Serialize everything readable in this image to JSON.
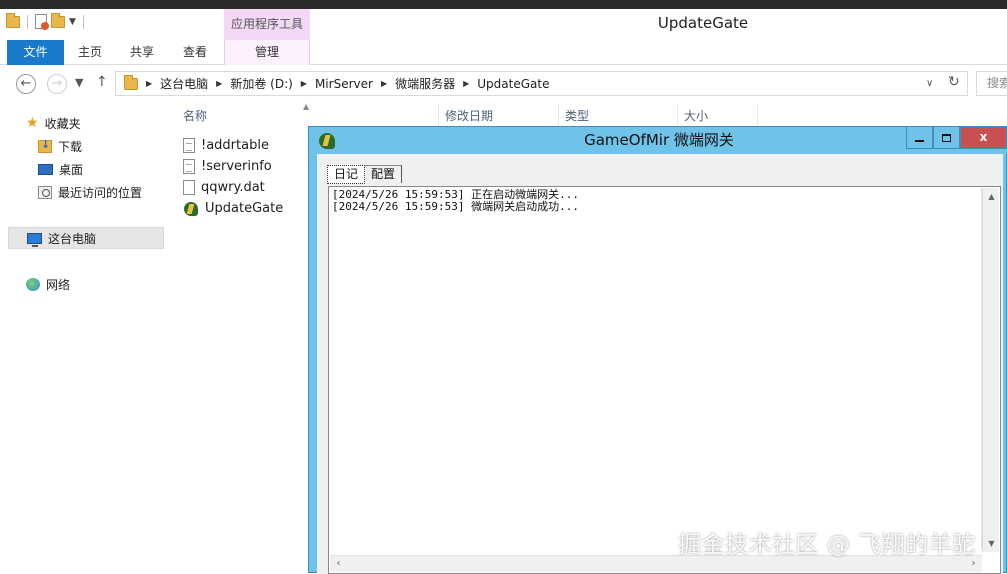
{
  "window": {
    "title": "UpdateGate",
    "tool_tab_title": "应用程序工具"
  },
  "ribbon": {
    "tabs": [
      "文件",
      "主页",
      "共享",
      "查看",
      "管理"
    ]
  },
  "address": {
    "crumbs": [
      "这台电脑",
      "新加卷 (D:)",
      "MirServer",
      "微端服务器",
      "UpdateGate"
    ],
    "search_placeholder": "搜索"
  },
  "navpane": {
    "favorites_label": "收藏夹",
    "favorites": [
      "下载",
      "桌面",
      "最近访问的位置"
    ],
    "this_pc": "这台电脑",
    "network": "网络"
  },
  "filelist": {
    "columns": [
      "名称",
      "修改日期",
      "类型",
      "大小"
    ],
    "files": [
      {
        "name": "!addrtable",
        "icon": "text-file-icon"
      },
      {
        "name": "!serverinfo",
        "icon": "text-file-icon"
      },
      {
        "name": "qqwry.dat",
        "icon": "file-icon"
      },
      {
        "name": "UpdateGate",
        "icon": "app-icon"
      }
    ]
  },
  "dialog": {
    "title": "GameOfMir 微端网关",
    "close_label": "x",
    "tabs": [
      "日记",
      "配置"
    ],
    "log_lines": [
      "[2024/5/26 15:59:53] 正在启动微端网关...",
      "[2024/5/26 15:59:53] 微端网关启动成功..."
    ]
  },
  "watermark": "掘金技术社区 @ 飞翔的羊驼",
  "colors": {
    "file_tab": "#1979ca",
    "tool_tab": "#f4d9f6",
    "dialog_frame": "#6fc3e8",
    "close_button": "#c75050"
  }
}
